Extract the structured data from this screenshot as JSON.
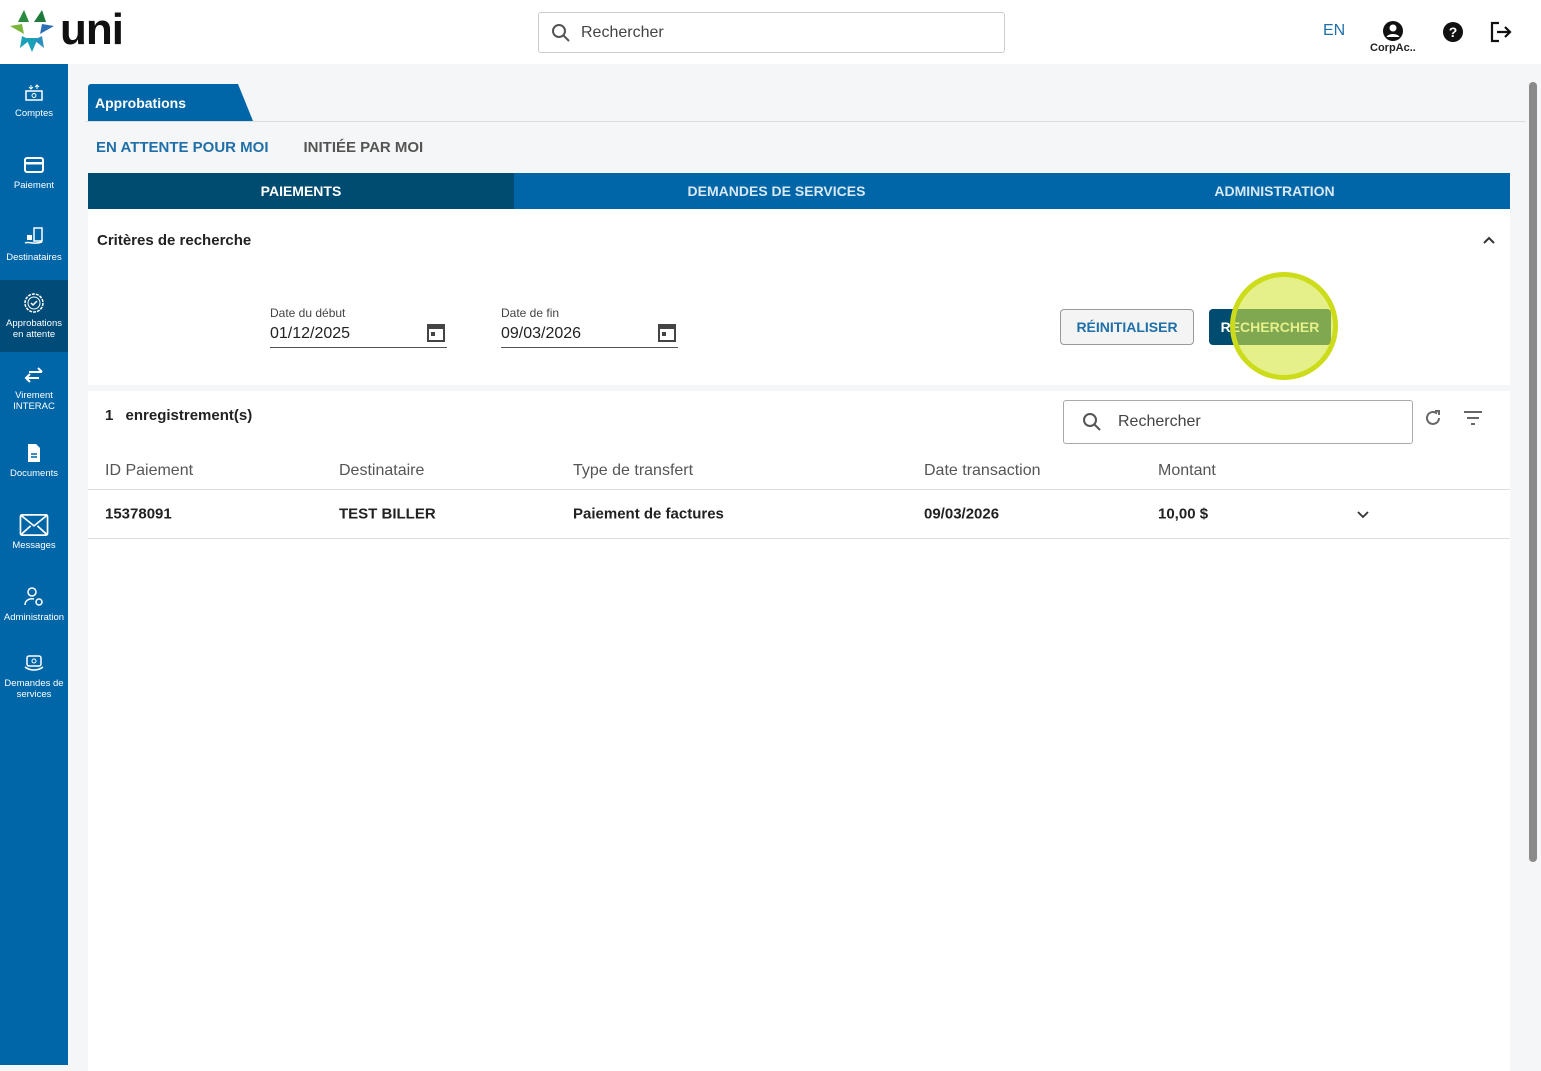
{
  "header": {
    "logo": "uni",
    "search_placeholder": "Rechercher",
    "lang": "EN",
    "user": "CorpAc.."
  },
  "sidebar": [
    {
      "label": "Comptes",
      "icon": "accounts-icon"
    },
    {
      "label": "Paiement",
      "icon": "card-icon"
    },
    {
      "label": "Destinataires",
      "icon": "payees-icon"
    },
    {
      "label": "Approbations en attente",
      "icon": "approval-icon"
    },
    {
      "label": "Virement INTERAC",
      "icon": "transfer-icon"
    },
    {
      "label": "Documents",
      "icon": "document-icon"
    },
    {
      "label": "Messages",
      "icon": "mail-icon"
    },
    {
      "label": "Administration",
      "icon": "user-gear-icon"
    },
    {
      "label": "Demandes de services",
      "icon": "service-icon"
    }
  ],
  "page_tab": "Approbations",
  "subtabs": [
    "EN ATTENTE POUR MOI",
    "INITIÉE PAR MOI"
  ],
  "category_tabs": [
    "PAIEMENTS",
    "DEMANDES DE SERVICES",
    "ADMINISTRATION"
  ],
  "criteria": {
    "title": "Critères de recherche",
    "start_label": "Date du début",
    "start_value": "01/12/2025",
    "end_label": "Date de fin",
    "end_value": "09/03/2026",
    "reset": "RÉINITIALISER",
    "search": "RECHERCHER"
  },
  "results": {
    "count": "1",
    "count_label": "enregistrement(s)",
    "search_placeholder": "Rechercher",
    "columns": [
      "ID Paiement",
      "Destinataire",
      "Type de transfert",
      "Date transaction",
      "Montant"
    ],
    "rows": [
      [
        "15378091",
        "TEST BILLER",
        "Paiement de factures",
        "09/03/2026",
        "10,00 $"
      ]
    ]
  }
}
